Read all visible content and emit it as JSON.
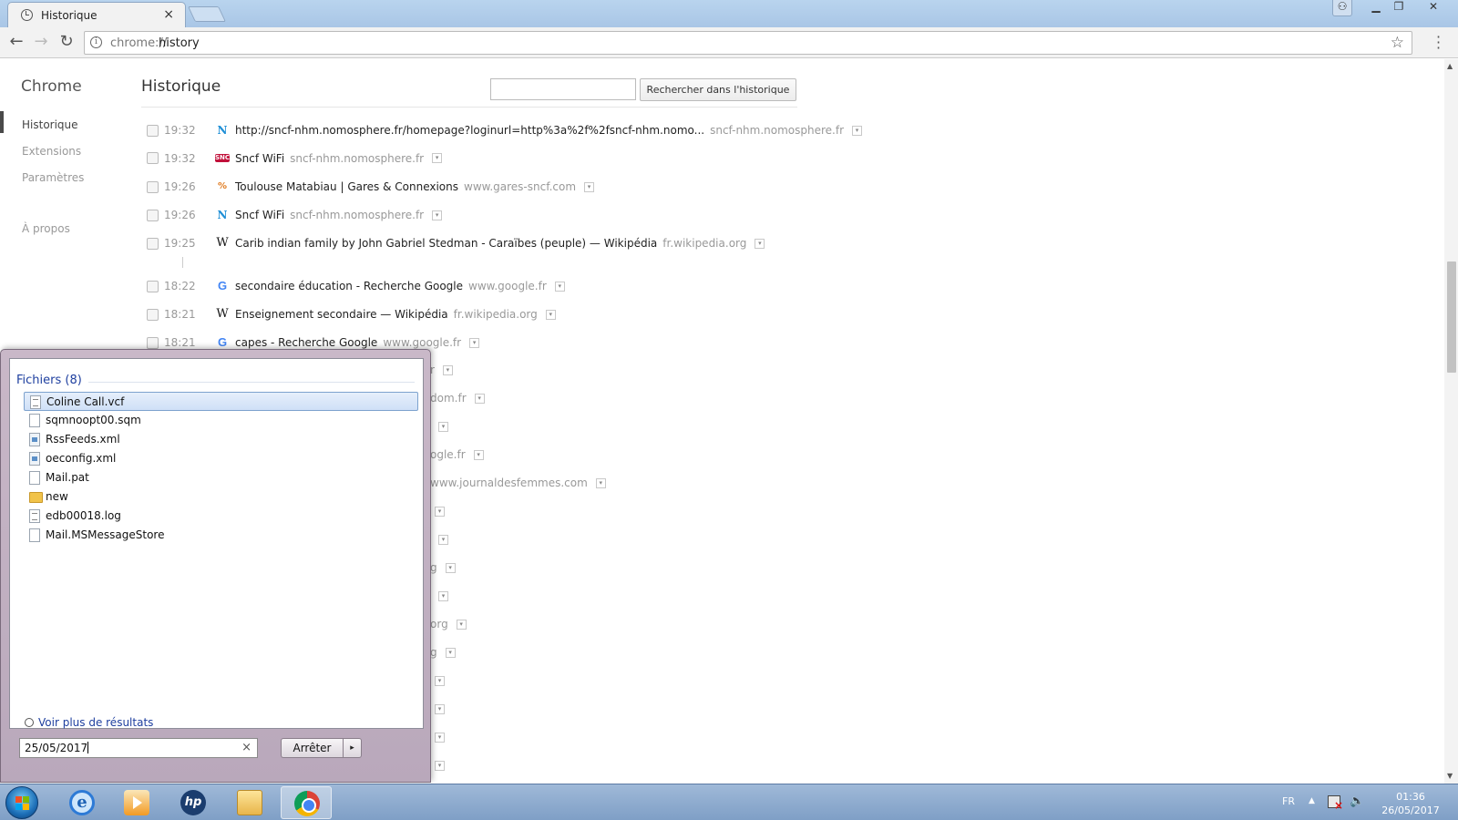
{
  "browser": {
    "tab_title": "Historique",
    "tab_close": "×",
    "url_scheme": "chrome://",
    "url_path": "history",
    "star_icon": "☆"
  },
  "sidebar": {
    "brand": "Chrome",
    "items": [
      {
        "label": "Historique",
        "active": true
      },
      {
        "label": "Extensions"
      },
      {
        "label": "Paramètres"
      },
      {
        "label": "À propos"
      }
    ]
  },
  "main": {
    "title": "Historique",
    "search_placeholder": "",
    "search_button": "Rechercher dans l'historique"
  },
  "history": [
    {
      "time": "19:32",
      "favicon": "nomosphere-icon",
      "title": "http://sncf-nhm.nomosphere.fr/homepage?loginurl=http%3a%2f%2fsncf-nhm.nomo...",
      "domain": "sncf-nhm.nomosphere.fr"
    },
    {
      "time": "19:32",
      "favicon": "sncf-icon",
      "title": "Sncf WiFi",
      "domain": "sncf-nhm.nomosphere.fr"
    },
    {
      "time": "19:26",
      "favicon": "gares-icon",
      "title": "Toulouse Matabiau | Gares & Connexions",
      "domain": "www.gares-sncf.com"
    },
    {
      "time": "19:26",
      "favicon": "nomosphere-icon",
      "title": "Sncf WiFi",
      "domain": "sncf-nhm.nomosphere.fr"
    },
    {
      "time": "19:25",
      "favicon": "wikipedia-icon",
      "title": "Carib indian family by John Gabriel Stedman - Caraïbes (peuple) — Wikipédia",
      "domain": "fr.wikipedia.org"
    },
    {
      "time": "18:22",
      "favicon": "google-icon",
      "title": "secondaire éducation - Recherche Google",
      "domain": "www.google.fr"
    },
    {
      "time": "18:21",
      "favicon": "wikipedia-icon",
      "title": "Enseignement secondaire — Wikipédia",
      "domain": "fr.wikipedia.org"
    },
    {
      "time": "18:21",
      "favicon": "google-icon",
      "title": "capes - Recherche Google",
      "domain": "www.google.fr"
    }
  ],
  "history_partial": [
    {
      "text": "r"
    },
    {
      "text": "dom.fr"
    },
    {
      "text": ""
    },
    {
      "text": "ogle.fr"
    },
    {
      "text": "www.journaldesfemmes.com"
    },
    {
      "text": ""
    },
    {
      "text": ""
    },
    {
      "text": "g"
    },
    {
      "text": ""
    },
    {
      "text": "org"
    },
    {
      "text": "g"
    },
    {
      "text": ""
    },
    {
      "text": ""
    },
    {
      "text": ""
    },
    {
      "text": ""
    }
  ],
  "start_menu": {
    "heading": "Fichiers (8)",
    "files": [
      {
        "name": "Coline Call.vcf",
        "icon": "contact-file-icon",
        "selected": true
      },
      {
        "name": "sqmnoopt00.sqm",
        "icon": "blank-file-icon"
      },
      {
        "name": "RssFeeds.xml",
        "icon": "xml-file-icon"
      },
      {
        "name": "oeconfig.xml",
        "icon": "xml-file-icon"
      },
      {
        "name": "Mail.pat",
        "icon": "blank-file-icon"
      },
      {
        "name": "new",
        "icon": "folder-icon"
      },
      {
        "name": "edb00018.log",
        "icon": "text-file-icon"
      },
      {
        "name": "Mail.MSMessageStore",
        "icon": "blank-file-icon"
      }
    ],
    "more_results": "Voir plus de résultats",
    "search_value": "25/05/2017",
    "clear_icon": "×",
    "stop_button": "Arrêter",
    "stop_arrow": "▸"
  },
  "taskbar": {
    "apps": [
      "internet-explorer-icon",
      "media-player-icon",
      "hp-icon",
      "file-explorer-icon",
      "chrome-icon"
    ],
    "active_app": "chrome-icon",
    "language": "FR",
    "time": "01:36",
    "date": "26/05/2017"
  }
}
